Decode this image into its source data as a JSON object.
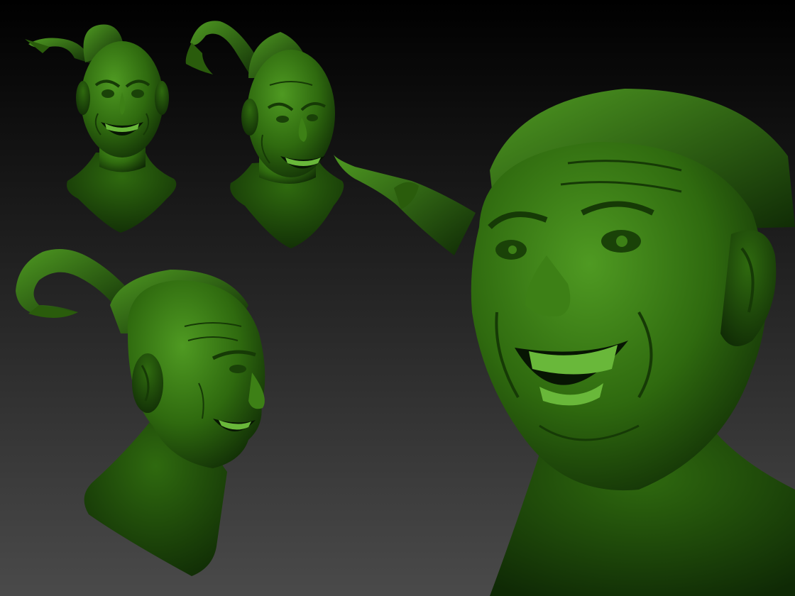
{
  "scene": {
    "background_top": "#000000",
    "background_bottom": "#4a4a4a",
    "sculpt_base": "#2f6a0f",
    "sculpt_light": "#4f9a22",
    "sculpt_shadow": "#0f2a05",
    "tooth_color": "#69b83a",
    "mouth_color": "#071503"
  },
  "views": [
    {
      "name": "front-view-small"
    },
    {
      "name": "three-quarter-view-small"
    },
    {
      "name": "side-profile-view"
    },
    {
      "name": "close-up-face-view"
    }
  ]
}
